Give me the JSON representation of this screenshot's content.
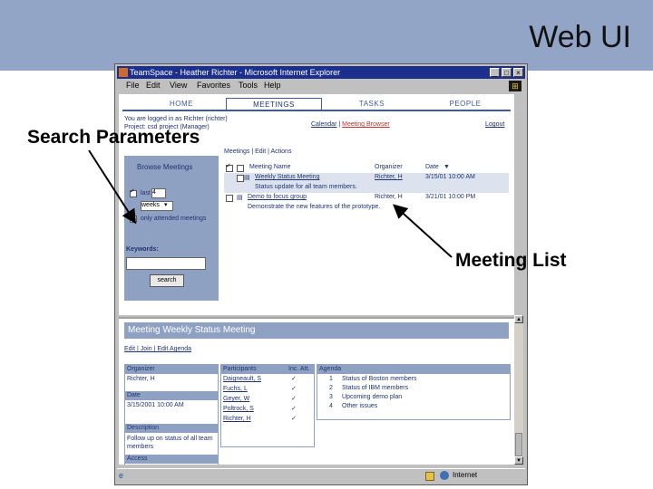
{
  "slide": {
    "title": "Web UI",
    "callout_search": "Search Parameters",
    "callout_meeting": "Meeting List"
  },
  "browser": {
    "title": "TeamSpace - Heather Richter - Microsoft Internet Explorer",
    "menu": [
      "File",
      "Edit",
      "View",
      "Favorites",
      "Tools",
      "Help"
    ],
    "status_zone": "Internet"
  },
  "app": {
    "tabs": [
      {
        "label": "HOME",
        "active": false
      },
      {
        "label": "MEETINGS",
        "active": true
      },
      {
        "label": "TASKS",
        "active": false
      },
      {
        "label": "PEOPLE",
        "active": false
      }
    ],
    "user_line1": "You are logged in as Richter (richter)",
    "user_line2": "Project: csd project (Manager)",
    "nav_calendar": "Calendar",
    "nav_sep": "|",
    "nav_browser": "Meeting Browser",
    "logout": "Logout",
    "breadcrumbs": "Meetings | Edit | Actions"
  },
  "browse": {
    "title": "Browse Meetings",
    "last_label": "last",
    "last_count": "4",
    "unit": "weeks",
    "only_attended": "only attended meetings",
    "keywords_label": "Keywords:",
    "keywords_value": "",
    "search_button": "search"
  },
  "meetings": {
    "columns": {
      "name": "Meeting Name",
      "organizer": "Organizer",
      "date": "Date"
    },
    "rows": [
      {
        "name": "Weekly Status Meeting",
        "organizer": "Richter, H",
        "date": "3/15/01 10:00 AM",
        "note": "Status update for all team members."
      },
      {
        "name": "Demo to focus group",
        "organizer": "Richter, H",
        "date": "3/21/01 10:00 PM",
        "note": "Demonstrate the new features of the prototype."
      }
    ]
  },
  "detail": {
    "header": "Meeting Weekly Status Meeting",
    "links": "Edit | Join | Edit Agenda",
    "organizer_label": "Organizer",
    "organizer_value": "Richter, H",
    "date_label": "Date",
    "date_value": "3/15/2001 10:00 AM",
    "description_label": "Description",
    "description_value": "Follow up on status of all team members",
    "access_label": "Access",
    "participants_label": "Participants",
    "attended_label": "Inc. Att.",
    "participants": [
      {
        "name": "Daigneault, S",
        "attended": "✓"
      },
      {
        "name": "Fuchs, L",
        "attended": "✓"
      },
      {
        "name": "Geyer, W",
        "attended": "✓"
      },
      {
        "name": "Poltrock, S",
        "attended": "✓"
      },
      {
        "name": "Richter, H",
        "attended": "✓"
      }
    ],
    "agenda_label": "Agenda",
    "agenda": [
      {
        "num": "1",
        "text": "Status of Boston members"
      },
      {
        "num": "2",
        "text": "Status of IBM members"
      },
      {
        "num": "3",
        "text": "Upcoming demo plan"
      },
      {
        "num": "4",
        "text": "Other issues"
      }
    ]
  }
}
